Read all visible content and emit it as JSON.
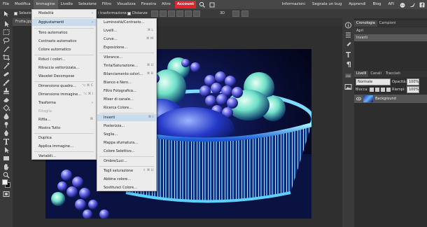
{
  "menubar": {
    "items": [
      "File",
      "Modifica",
      "Immagine",
      "Livello",
      "Selezione",
      "Filtro",
      "Visualizza",
      "Finestra",
      "Altro"
    ],
    "account": "Account",
    "right_items": [
      "Informazioni",
      "Segnala un bug",
      "Apprendi",
      "Blog",
      "API"
    ]
  },
  "optbar": {
    "selezione_label": "Selezion",
    "trasformazione_label": "i trasformazione",
    "distanze_label": "Distanze",
    "mode_3d": "3D"
  },
  "document": {
    "tab_label": "Frutta.jpg"
  },
  "image_menu": {
    "items": [
      {
        "label": "Modalità",
        "shortcut": "",
        "submenu": true,
        "dim": false
      },
      {
        "label": "Aggiustamenti",
        "shortcut": "",
        "submenu": true,
        "dim": false,
        "highlight": true
      },
      {
        "label": "Tono automatico",
        "shortcut": "",
        "submenu": false,
        "dim": false
      },
      {
        "label": "Contrasto automatico",
        "shortcut": "",
        "submenu": false,
        "dim": false
      },
      {
        "label": "Colore automatico",
        "shortcut": "",
        "submenu": false,
        "dim": false
      },
      {
        "label": "Riduci i colori…",
        "shortcut": "",
        "submenu": false,
        "dim": false
      },
      {
        "label": "Ritraccia vettorizzata…",
        "shortcut": "",
        "submenu": false,
        "dim": false
      },
      {
        "label": "Wavelet Decompose",
        "shortcut": "",
        "submenu": false,
        "dim": false
      },
      {
        "label": "Dimensione quadro…",
        "shortcut": "⌥ ⌘ C",
        "submenu": false,
        "dim": false
      },
      {
        "label": "Dimensione immagine…",
        "shortcut": "⌥ ⌘ I",
        "submenu": false,
        "dim": false
      },
      {
        "label": "Trasforma",
        "shortcut": "",
        "submenu": true,
        "dim": false
      },
      {
        "label": "Ritaglia",
        "shortcut": "",
        "submenu": false,
        "dim": true
      },
      {
        "label": "Rifila…",
        "shortcut": "⌘",
        "submenu": false,
        "dim": false
      },
      {
        "label": "Mostra Tutto",
        "shortcut": "",
        "submenu": false,
        "dim": false
      },
      {
        "label": "Duplica",
        "shortcut": "",
        "submenu": false,
        "dim": false
      },
      {
        "label": "Applica immagine…",
        "shortcut": "",
        "submenu": false,
        "dim": false
      },
      {
        "label": "Variabili…",
        "shortcut": "",
        "submenu": false,
        "dim": false
      }
    ]
  },
  "adjust_menu": {
    "items": [
      {
        "label": "Luminosità/Contrasto…",
        "shortcut": ""
      },
      {
        "label": "Livelli…",
        "shortcut": "⌘ L"
      },
      {
        "label": "Curve…",
        "shortcut": "⌘ M"
      },
      {
        "label": "Esposizione…",
        "shortcut": ""
      },
      {
        "label": "Vibrance…",
        "shortcut": ""
      },
      {
        "label": "Tinta/Saturazione…",
        "shortcut": "⌘ U"
      },
      {
        "label": "Bilanciamento colori…",
        "shortcut": "⌘ B"
      },
      {
        "label": "Bianco e Nero…",
        "shortcut": ""
      },
      {
        "label": "Filtro Fotografico…",
        "shortcut": ""
      },
      {
        "label": "Mixer di canale…",
        "shortcut": ""
      },
      {
        "label": "Ricerca Colore…",
        "shortcut": ""
      },
      {
        "label": "Inverti",
        "shortcut": "⌘ I",
        "highlight": true
      },
      {
        "label": "Posterizza…",
        "shortcut": ""
      },
      {
        "label": "Soglia…",
        "shortcut": ""
      },
      {
        "label": "Mappa sfumatura…",
        "shortcut": ""
      },
      {
        "label": "Colore Selettivo…",
        "shortcut": ""
      },
      {
        "label": "Ombre/Luci…",
        "shortcut": ""
      },
      {
        "label": "Togli saturazione",
        "shortcut": "⇧ ⌘ U"
      },
      {
        "label": "Abbina colore…",
        "shortcut": ""
      },
      {
        "label": "Sostituisci Colore…",
        "shortcut": ""
      }
    ]
  },
  "history_panel": {
    "tabs": [
      "Cronologia",
      "Campioni"
    ],
    "entries": [
      "Apri",
      "Inverti"
    ]
  },
  "layers_panel": {
    "tabs": [
      "Livelli",
      "Canali",
      "Tracciati"
    ],
    "blend_mode": "Normale",
    "opacity_label": "Opacità:",
    "opacity_value": "100%",
    "lock_label": "Blocca:",
    "fill_label": "Riempi:",
    "fill_value": "100%",
    "layer_name": "Background"
  },
  "colors": {
    "accent": "#e2232b",
    "menu_bg": "#ececec",
    "highlight": "#c8dced"
  }
}
